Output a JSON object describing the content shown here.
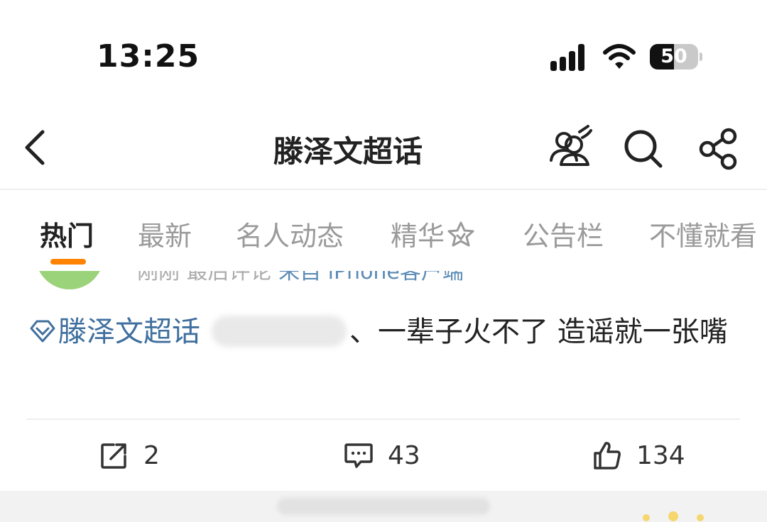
{
  "status_bar": {
    "time": "13:25",
    "battery_level": "50",
    "battery_fraction": 0.5,
    "icons": [
      "signal-icon",
      "wifi-icon",
      "battery-icon"
    ]
  },
  "nav": {
    "title": "滕泽文超话",
    "icons": [
      "back-icon",
      "people-icon",
      "search-icon",
      "share-icon"
    ]
  },
  "tabs": [
    {
      "label": "热门",
      "active": true
    },
    {
      "label": "最新",
      "active": false
    },
    {
      "label": "名人动态",
      "active": false
    },
    {
      "label": "精华",
      "active": false,
      "icon": "star-icon"
    },
    {
      "label": "公告栏",
      "active": false
    },
    {
      "label": "不懂就看",
      "active": false
    }
  ],
  "post": {
    "meta_time": "刚刚",
    "meta_comment": "最后评论",
    "meta_source": "来自 iPhone客户端",
    "topic": "滕泽文超话",
    "text": "、一辈子火不了 造谣就一张嘴",
    "actions": {
      "repost_count": "2",
      "comment_count": "43",
      "like_count": "134"
    }
  },
  "colors": {
    "accent": "#ff8200",
    "link": "#3f6f9e",
    "muted": "#9a9a9a"
  }
}
